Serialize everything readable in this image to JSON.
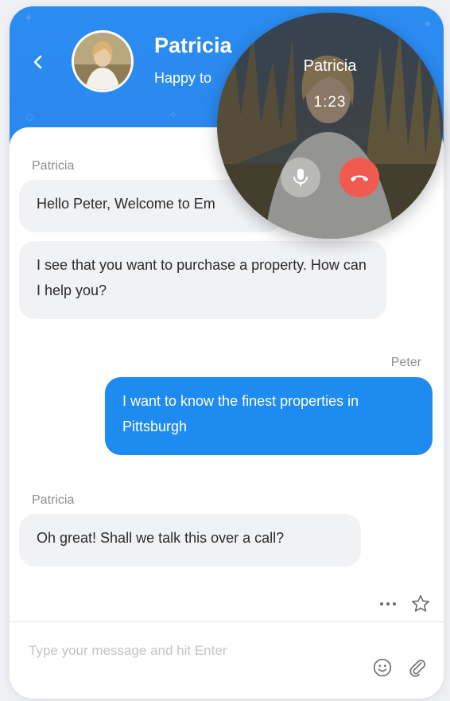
{
  "header": {
    "contact_name": "Patricia",
    "contact_status": "Happy to"
  },
  "messages": [
    {
      "from": "Patricia",
      "direction": "in",
      "text": "Hello Peter, Welcome to Em"
    },
    {
      "from": "",
      "direction": "in",
      "text": "I see that you want to purchase a property. How can I help you?"
    },
    {
      "from": "Peter",
      "direction": "out",
      "text": "I want to know the finest properties in Pittsburgh"
    },
    {
      "from": "Patricia",
      "direction": "in",
      "text": "Oh great! Shall we talk this over a call?"
    }
  ],
  "composer": {
    "placeholder": "Type your message and hit Enter"
  },
  "call": {
    "name": "Patricia",
    "timer": "1:23"
  },
  "icons": {
    "back": "chevron-left-icon",
    "more": "ellipsis-icon",
    "star": "star-outline-icon",
    "emoji": "smiley-icon",
    "attach": "paperclip-icon",
    "mic": "microphone-icon",
    "hangup": "phone-hangup-icon"
  },
  "colors": {
    "accent": "#1d8bf0",
    "header": "#2b8cf0",
    "hangup": "#f05a4f",
    "bubble_in": "#f1f2f4"
  }
}
